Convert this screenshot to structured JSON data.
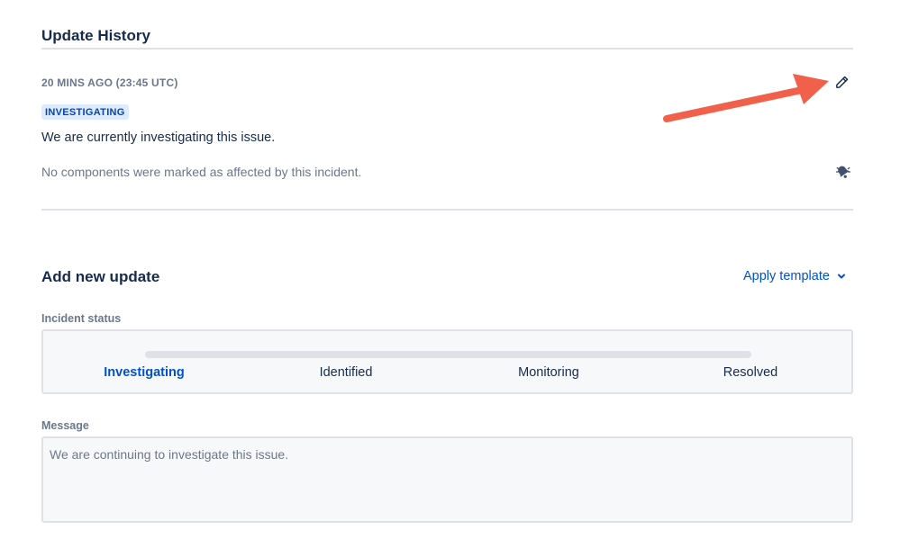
{
  "update_history": {
    "title": "Update History",
    "entry": {
      "timestamp": "20 MINS AGO (23:45 UTC)",
      "status": "INVESTIGATING",
      "body": "We are currently investigating this issue.",
      "components_note": "No components were marked as affected by this incident."
    }
  },
  "add_update": {
    "title": "Add new update",
    "apply_template_label": "Apply template",
    "incident_status": {
      "label": "Incident status",
      "options": [
        "Investigating",
        "Identified",
        "Monitoring",
        "Resolved"
      ],
      "selected": "Investigating"
    },
    "message": {
      "label": "Message",
      "placeholder": "We are continuing to investigate this issue."
    }
  },
  "icons": {
    "edit": "pencil-icon",
    "notify": "bell-icon",
    "dropdown": "chevron-down-icon"
  },
  "colors": {
    "accent": "#0052cc",
    "badge_bg": "#deebff",
    "annotation_arrow": "#f0604a"
  }
}
